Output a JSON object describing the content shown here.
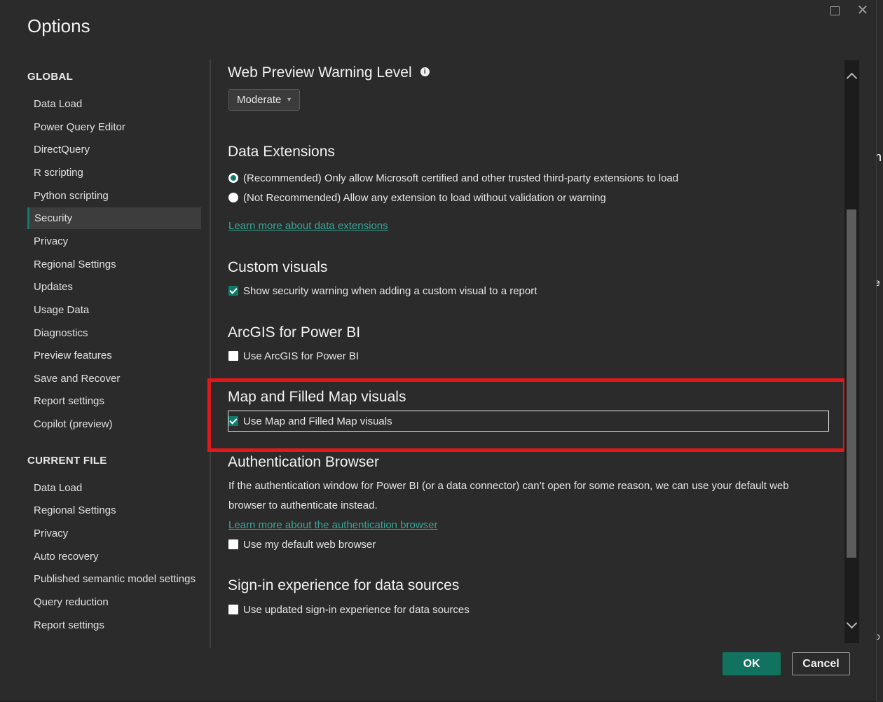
{
  "dialog": {
    "title": "Options"
  },
  "nav": {
    "global_heading": "GLOBAL",
    "global_items": [
      {
        "label": "Data Load"
      },
      {
        "label": "Power Query Editor"
      },
      {
        "label": "DirectQuery"
      },
      {
        "label": "R scripting"
      },
      {
        "label": "Python scripting"
      },
      {
        "label": "Security",
        "selected": true
      },
      {
        "label": "Privacy"
      },
      {
        "label": "Regional Settings"
      },
      {
        "label": "Updates"
      },
      {
        "label": "Usage Data"
      },
      {
        "label": "Diagnostics"
      },
      {
        "label": "Preview features"
      },
      {
        "label": "Save and Recover"
      },
      {
        "label": "Report settings"
      },
      {
        "label": "Copilot (preview)"
      }
    ],
    "current_heading": "CURRENT FILE",
    "current_items": [
      {
        "label": "Data Load"
      },
      {
        "label": "Regional Settings"
      },
      {
        "label": "Privacy"
      },
      {
        "label": "Auto recovery"
      },
      {
        "label": "Published semantic model settings"
      },
      {
        "label": "Query reduction"
      },
      {
        "label": "Report settings"
      }
    ]
  },
  "content": {
    "web_preview": {
      "title": "Web Preview Warning Level",
      "dropdown_value": "Moderate"
    },
    "data_extensions": {
      "title": "Data Extensions",
      "option_recommended": "(Recommended) Only allow Microsoft certified and other trusted third-party extensions to load",
      "option_not_recommended": "(Not Recommended) Allow any extension to load without validation or warning",
      "link": "Learn more about data extensions"
    },
    "custom_visuals": {
      "title": "Custom visuals",
      "checkbox_label": "Show security warning when adding a custom visual to a report",
      "checked": true
    },
    "arcgis": {
      "title": "ArcGIS for Power BI",
      "checkbox_label": "Use ArcGIS for Power BI",
      "checked": false
    },
    "map_visuals": {
      "title": "Map and Filled Map visuals",
      "checkbox_label": "Use Map and Filled Map visuals",
      "checked": true
    },
    "auth_browser": {
      "title": "Authentication Browser",
      "description": "If the authentication window for Power BI (or a data connector) can’t open for some reason, we can use your default web browser to authenticate instead.",
      "link": "Learn more about the authentication browser",
      "checkbox_label": "Use my default web browser",
      "checked": false
    },
    "signin": {
      "title": "Sign-in experience for data sources",
      "checkbox_label": "Use updated sign-in experience for data sources",
      "checked": false
    }
  },
  "footer": {
    "ok_label": "OK",
    "cancel_label": "Cancel"
  },
  "colors": {
    "accent": "#0f7b6c",
    "highlight": "#e0191b",
    "link": "#3aa596"
  }
}
